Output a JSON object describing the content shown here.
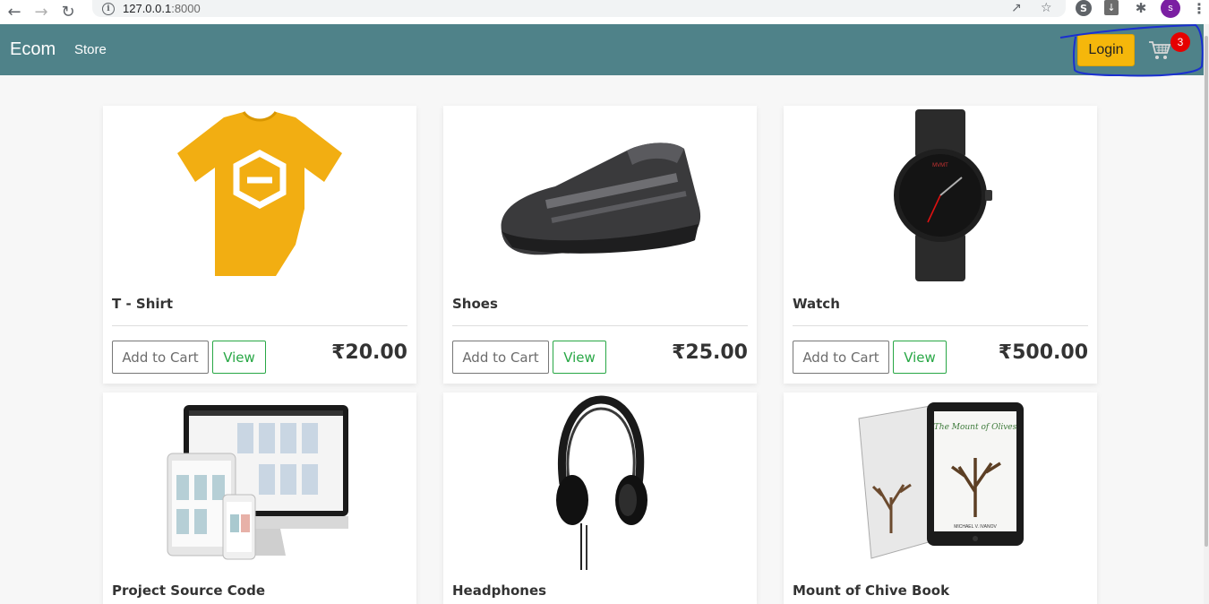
{
  "browser": {
    "url_host": "127.0.0.1",
    "url_port": ":8000",
    "profile_initial": "s"
  },
  "navbar": {
    "brand": "Ecom",
    "store_link": "Store",
    "login_label": "Login",
    "cart_count": "3",
    "bg_color": "#4f8289",
    "login_color": "#f5b70b"
  },
  "products": [
    {
      "title": "T - Shirt",
      "price": "₹20.00",
      "add_label": "Add to Cart",
      "view_label": "View",
      "image_icon": "tshirt-image"
    },
    {
      "title": "Shoes",
      "price": "₹25.00",
      "add_label": "Add to Cart",
      "view_label": "View",
      "image_icon": "shoes-image"
    },
    {
      "title": "Watch",
      "price": "₹500.00",
      "add_label": "Add to Cart",
      "view_label": "View",
      "image_icon": "watch-image"
    },
    {
      "title": "Project Source Code",
      "image_icon": "devices-image"
    },
    {
      "title": "Headphones",
      "image_icon": "headphones-image"
    },
    {
      "title": "Mount of Chive Book",
      "image_icon": "book-image"
    }
  ]
}
